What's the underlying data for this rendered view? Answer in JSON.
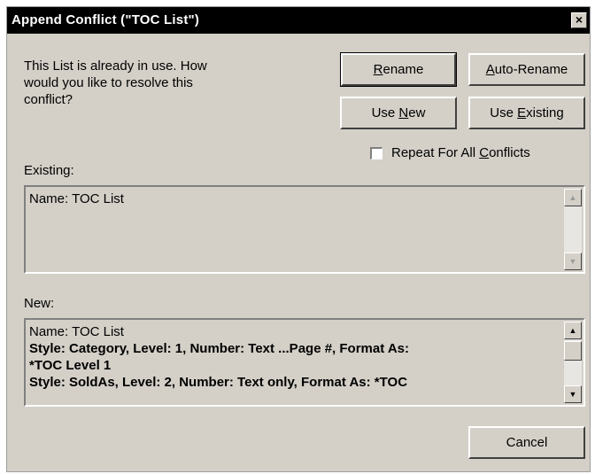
{
  "window": {
    "title": "Append Conflict (\"TOC List\")",
    "close_glyph": "×"
  },
  "message": "This List is already in use. How\nwould you like to resolve this\nconflict?",
  "buttons": {
    "rename": {
      "pre": "",
      "accel": "R",
      "post": "ename"
    },
    "auto_rename": {
      "pre": "",
      "accel": "A",
      "post": "uto-Rename"
    },
    "use_new": {
      "pre": "Use ",
      "accel": "N",
      "post": "ew"
    },
    "use_existing": {
      "pre": "Use ",
      "accel": "E",
      "post": "xisting"
    },
    "cancel": "Cancel"
  },
  "repeat_checkbox": {
    "label_pre": "Repeat For All ",
    "label_accel": "C",
    "label_post": "onflicts",
    "checked": false
  },
  "existing": {
    "label": "Existing:",
    "lines": [
      "Name: TOC List"
    ]
  },
  "new": {
    "label": "New:",
    "name_line": "Name: TOC List",
    "style_line_1": "Style: Category, Level: 1, Number: Text ...Page #, Format As:",
    "style_line_1b": "*TOC Level 1",
    "style_line_2": "Style: SoldAs, Level: 2, Number: Text only, Format As: *TOC"
  },
  "icons": {
    "scroll_up": "▲",
    "scroll_down": "▼"
  }
}
